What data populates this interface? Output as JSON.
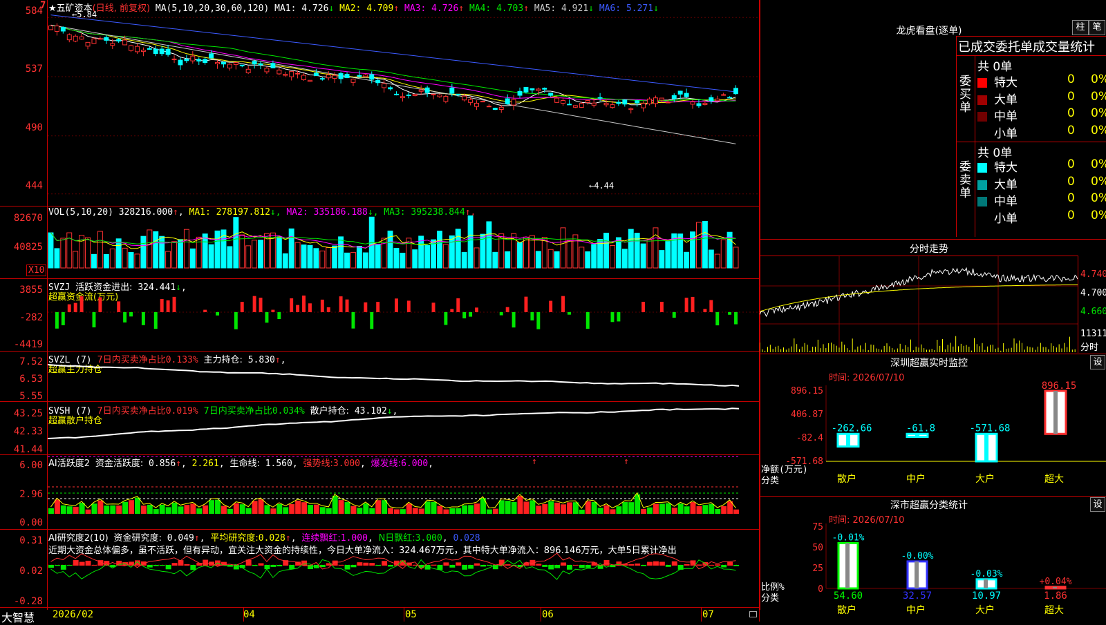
{
  "stock": {
    "name": "五矿资本",
    "period_label": "(日线, 前复权)",
    "star": "★",
    "mark_top_left": "7"
  },
  "ma_line": {
    "prefix": "MA(5,10,20,30,60,120)",
    "items": [
      {
        "label": "MA1:",
        "value": "4.726",
        "arrow": "↓",
        "color": "#ffffff"
      },
      {
        "label": "MA2:",
        "value": "4.709",
        "arrow": "↑",
        "color": "#ffff00"
      },
      {
        "label": "MA3:",
        "value": "4.726",
        "arrow": "↑",
        "color": "#ff00ff"
      },
      {
        "label": "MA4:",
        "value": "4.703",
        "arrow": "↑",
        "color": "#00e600"
      },
      {
        "label": "MA5:",
        "value": "4.921",
        "arrow": "↓",
        "color": "#c8c8c8"
      },
      {
        "label": "MA6:",
        "value": "5.271",
        "arrow": "↓",
        "color": "#3c5aff"
      }
    ]
  },
  "price_axis": [
    "584",
    "537",
    "490",
    "444"
  ],
  "price_marks": {
    "high": "←5.84",
    "low": "←4.44"
  },
  "vol": {
    "header": "VOL(5,10,20)",
    "value": "328216.000",
    "v_arrow": "↑",
    "items": [
      {
        "label": "MA1:",
        "value": "278197.812",
        "arrow": "↓",
        "color": "#ffff00"
      },
      {
        "label": "MA2:",
        "value": "335186.188",
        "arrow": "↓",
        "color": "#ff00ff"
      },
      {
        "label": "MA3:",
        "value": "395238.844",
        "arrow": "↑",
        "color": "#00e600"
      }
    ],
    "axis": [
      "82670",
      "40825"
    ],
    "unit": "X10"
  },
  "svzj": {
    "header": "SVZJ",
    "label": "活跃资金进出:",
    "value": "324.441",
    "arrow": "↓",
    "sub": "超赢资金流(万元)",
    "axis": [
      "3855",
      "-282",
      "-4419"
    ]
  },
  "svzl": {
    "header": "SVZL (7)",
    "ratio_label": "7日内买卖净占比",
    "ratio_value": "0.133%",
    "main_label": "主力持仓:",
    "main_value": "5.830",
    "arrow": "↑",
    "sub": "超赢主力持仓",
    "axis": [
      "7.52",
      "6.53",
      "5.55"
    ]
  },
  "svsh": {
    "header": "SVSH (7)",
    "ratio1_label": "7日内买卖净占比",
    "ratio1_value": "0.019%",
    "ratio2_label": "7日内买卖净占比",
    "ratio2_value": "0.034%",
    "retail_label": "散户持仓:",
    "retail_value": "43.102",
    "arrow": "↓",
    "sub": "超赢散户持仓",
    "axis": [
      "43.25",
      "42.33",
      "41.44"
    ]
  },
  "ai_active": {
    "header": "AI活跃度2",
    "label": "资金活跃度:",
    "value": "0.856",
    "v2": "2.261",
    "life_label": "生命线:",
    "life_value": "1.560",
    "strong_label": "强势线:",
    "strong_value": "3.000",
    "burst_label": "爆发线:",
    "burst_value": "6.000",
    "axis": [
      "6.00",
      "2.96",
      "0.00"
    ]
  },
  "ai_research": {
    "header": "AI研究度2(10)",
    "label": "资金研究度:",
    "value": "0.049",
    "avg_label": "平均研究度:",
    "avg_value": "0.028",
    "red_label": "连续飘红:",
    "red_value": "1.000",
    "nred_label": "N日飘红:",
    "nred_value": "3.000",
    "last_value": "0.028",
    "comment": "近期大资金总体偏多，虽不活跃，但有异动，宜关注大资金的持续性，今日大单净流入：324.467万元，其中特大单净流入：896.146万元，大单5日累计净出",
    "axis": [
      "0.31",
      "0.02",
      "-0.28"
    ]
  },
  "time_axis": {
    "brand": "大智慧",
    "labels": [
      "2026/02",
      "04",
      "05",
      "06",
      "07"
    ]
  },
  "right_top": {
    "title": "龙虎看盘(逐单)",
    "btn1": "柱",
    "btn2": "笔",
    "stat_title": "已成交委托单成交量统计",
    "buy_label": "委买单",
    "sell_label": "委卖单",
    "buy_total": "共 0单",
    "sell_total": "共 0单",
    "buy_rows": [
      {
        "name": "特大",
        "count": "0",
        "pct": "0%",
        "color": "#ff0000"
      },
      {
        "name": "大单",
        "count": "0",
        "pct": "0%",
        "color": "#a00000"
      },
      {
        "name": "中单",
        "count": "0",
        "pct": "0%",
        "color": "#700000"
      },
      {
        "name": "小单",
        "count": "0",
        "pct": "0%",
        "color": "#000000"
      }
    ],
    "sell_rows": [
      {
        "name": "特大",
        "count": "0",
        "pct": "0%",
        "color": "#00ffff"
      },
      {
        "name": "大单",
        "count": "0",
        "pct": "0%",
        "color": "#00a0a0"
      },
      {
        "name": "中单",
        "count": "0",
        "pct": "0%",
        "color": "#007878"
      },
      {
        "name": "小单",
        "count": "0",
        "pct": "0%",
        "color": "#000000"
      }
    ]
  },
  "intraday": {
    "title": "分时走势",
    "axis": [
      "4.740",
      "4.700",
      "4.660"
    ],
    "vol_label": "11311",
    "unit": "分时"
  },
  "sz_monitor": {
    "title": "深圳超赢实时监控",
    "set_btn": "设",
    "time_label": "时间: 2026/07/10",
    "axis": [
      "896.15",
      "406.87",
      "-82.4",
      "-571.68"
    ],
    "axis_title1": "净额(万元)",
    "axis_title2": "分类",
    "categories": [
      "散户",
      "中户",
      "大户",
      "超大"
    ],
    "values": [
      -262.66,
      -61.8,
      -571.68,
      896.15
    ],
    "value_labels": [
      "-262.66",
      "-61.8",
      "-571.68",
      "896.15"
    ]
  },
  "sz_class": {
    "title": "深市超赢分类统计",
    "set_btn": "设",
    "time_label": "时间: 2026/07/10",
    "axis": [
      "75",
      "50",
      "25",
      "0"
    ],
    "axis_title1": "比例%",
    "axis_title2": "分类",
    "categories": [
      "散户",
      "中户",
      "大户",
      "超大"
    ],
    "values": [
      54.6,
      32.57,
      10.97,
      1.86
    ],
    "changes": [
      "-0.01%",
      "-0.00%",
      "-0.03%",
      "+0.04%"
    ]
  },
  "colors": {
    "up": "#ff3232",
    "down": "#00ffff",
    "grid": "#b00000",
    "panel_border": "#c80000"
  }
}
